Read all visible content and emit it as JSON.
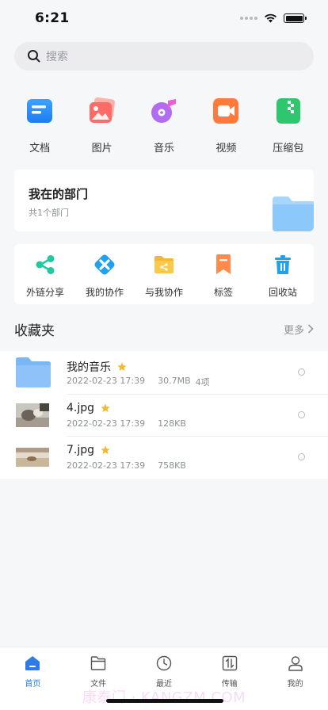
{
  "status_bar": {
    "time": "6:21"
  },
  "search": {
    "placeholder": "搜索"
  },
  "categories": [
    {
      "label": "文档",
      "icon": "document-icon"
    },
    {
      "label": "图片",
      "icon": "image-icon"
    },
    {
      "label": "音乐",
      "icon": "music-icon"
    },
    {
      "label": "视频",
      "icon": "video-icon"
    },
    {
      "label": "压缩包",
      "icon": "archive-icon"
    }
  ],
  "department": {
    "title": "我在的部门",
    "subtitle": "共1个部门"
  },
  "tools": [
    {
      "label": "外链分享",
      "icon": "share-link-icon"
    },
    {
      "label": "我的协作",
      "icon": "my-collab-icon"
    },
    {
      "label": "与我协作",
      "icon": "collab-with-me-icon"
    },
    {
      "label": "标签",
      "icon": "tag-icon"
    },
    {
      "label": "回收站",
      "icon": "trash-icon"
    }
  ],
  "favorites": {
    "title": "收藏夹",
    "more": "更多",
    "items": [
      {
        "name": "我的音乐",
        "date": "2022-02-23 17:39",
        "size": "30.7MB",
        "count": "4项",
        "type": "folder"
      },
      {
        "name": "4.jpg",
        "date": "2022-02-23 17:39",
        "size": "128KB",
        "count": "",
        "type": "image"
      },
      {
        "name": "7.jpg",
        "date": "2022-02-23 17:39",
        "size": "758KB",
        "count": "",
        "type": "image"
      }
    ]
  },
  "tabbar": [
    {
      "label": "首页",
      "active": true
    },
    {
      "label": "文件",
      "active": false
    },
    {
      "label": "最近",
      "active": false
    },
    {
      "label": "传输",
      "active": false
    },
    {
      "label": "我的",
      "active": false
    }
  ],
  "watermark": "康泰门 · KANGZM.COM",
  "colors": {
    "accent": "#2f7be6",
    "star": "#f5b82e",
    "folder": "#7bb6f5"
  }
}
